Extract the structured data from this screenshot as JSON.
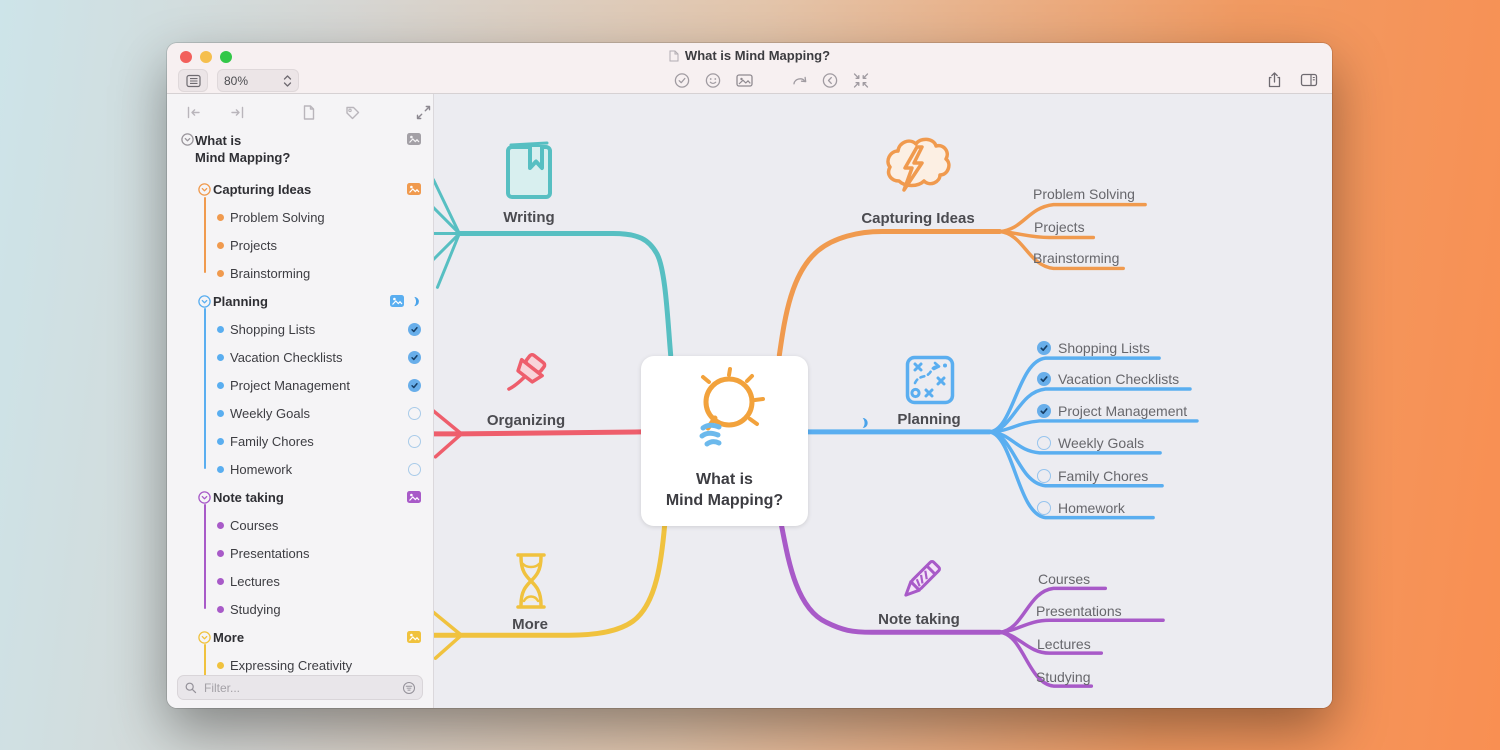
{
  "window": {
    "title": "What is Mind Mapping?",
    "zoom_level": "80%"
  },
  "sidebar": {
    "filter_placeholder": "Filter..."
  },
  "topics": {
    "root_title": "What is Mind Mapping?",
    "root_wrapped": "What is\nMind Mapping?",
    "writing": {
      "label": "Writing"
    },
    "organizing": {
      "label": "Organizing"
    },
    "capturing": {
      "label": "Capturing Ideas",
      "children": [
        {
          "label": "Problem Solving"
        },
        {
          "label": "Projects"
        },
        {
          "label": "Brainstorming"
        }
      ]
    },
    "planning": {
      "label": "Planning",
      "children": [
        {
          "label": "Shopping Lists",
          "checked": true
        },
        {
          "label": "Vacation Checklists",
          "checked": true
        },
        {
          "label": "Project Management",
          "checked": true
        },
        {
          "label": "Weekly Goals",
          "checked": false
        },
        {
          "label": "Family Chores",
          "checked": false
        },
        {
          "label": "Homework",
          "checked": false
        }
      ]
    },
    "notetaking": {
      "label": "Note taking",
      "children": [
        {
          "label": "Courses"
        },
        {
          "label": "Presentations"
        },
        {
          "label": "Lectures"
        },
        {
          "label": "Studying"
        }
      ]
    },
    "more": {
      "label": "More",
      "children": [
        {
          "label": "Expressing Creativity"
        }
      ]
    }
  },
  "colors": {
    "teal": "#57bfc2",
    "orange": "#f09a4e",
    "blue": "#5aaef0",
    "red": "#ee5e6c",
    "purple": "#a85ac8",
    "yellow": "#f0c23e",
    "task_checked": "#68aeea"
  },
  "icons": {
    "titlebar": [
      "document-proxy",
      "task-check",
      "emoji",
      "image",
      "undo",
      "previous-node",
      "zoom-to-fit",
      "share",
      "inspector-toggle"
    ],
    "sidebar_toolbar": [
      "collapse-all",
      "expand-all",
      "document",
      "tag",
      "expand-outline"
    ],
    "filter": [
      "magnifier",
      "filter-menu"
    ]
  }
}
